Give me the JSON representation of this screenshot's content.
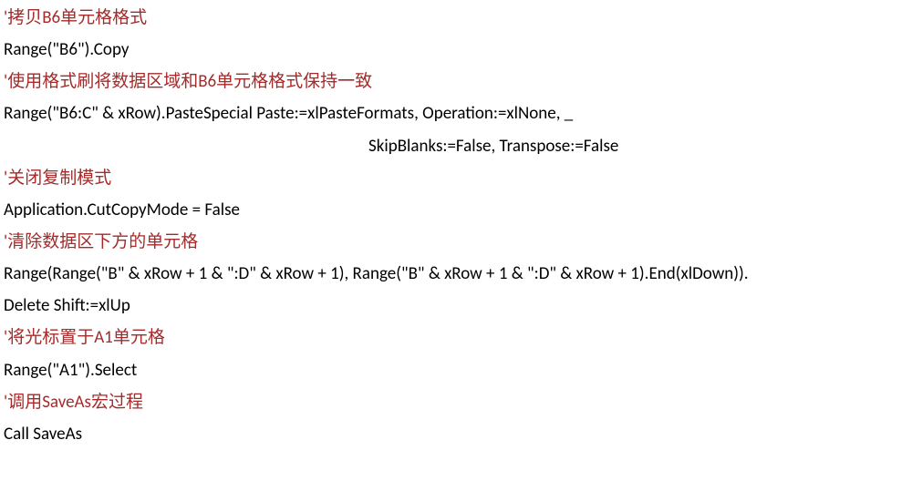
{
  "lines": [
    {
      "type": "comment",
      "text": "'拷贝B6单元格格式"
    },
    {
      "type": "code",
      "text": "Range(\"B6\").Copy"
    },
    {
      "type": "comment",
      "text": "'使用格式刷将数据区域和B6单元格格式保持一致"
    },
    {
      "type": "code",
      "text": "Range(\"B6:C\" & xRow).PasteSpecial Paste:=xlPasteFormats, Operation:=xlNone, _"
    },
    {
      "type": "code-indent",
      "text": "SkipBlanks:=False, Transpose:=False"
    },
    {
      "type": "comment",
      "text": "'关闭复制模式"
    },
    {
      "type": "code",
      "text": "Application.CutCopyMode = False"
    },
    {
      "type": "comment",
      "text": "'清除数据区下方的单元格"
    },
    {
      "type": "code",
      "text": "Range(Range(\"B\" & xRow + 1 & \":D\" & xRow + 1), Range(\"B\" & xRow + 1 & \":D\" & xRow + 1).End(xlDown))."
    },
    {
      "type": "code",
      "text": "Delete Shift:=xlUp"
    },
    {
      "type": "comment",
      "text": "'将光标置于A1单元格"
    },
    {
      "type": "code",
      "text": "Range(\"A1\").Select"
    },
    {
      "type": "comment",
      "text": "'调用SaveAs宏过程"
    },
    {
      "type": "code",
      "text": "Call SaveAs"
    }
  ]
}
